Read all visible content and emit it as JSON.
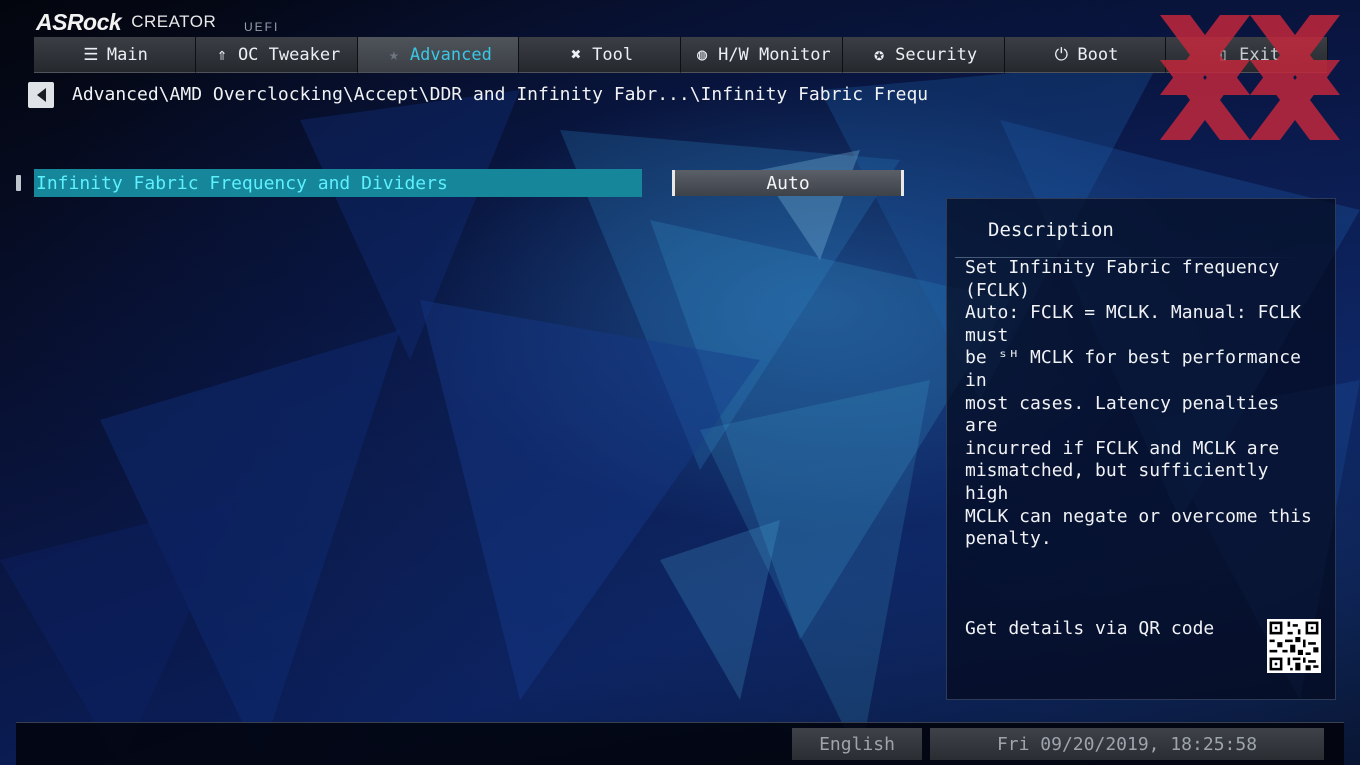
{
  "brand": {
    "name": "ASRock",
    "edition": "CREATOR",
    "suffix": "UEFI"
  },
  "tabs": [
    {
      "label": "Main",
      "icon": "list-icon",
      "active": false
    },
    {
      "label": "OC Tweaker",
      "icon": "rocket-icon",
      "active": false
    },
    {
      "label": "Advanced",
      "icon": "star-icon",
      "active": true
    },
    {
      "label": "Tool",
      "icon": "tools-icon",
      "active": false
    },
    {
      "label": "H/W Monitor",
      "icon": "monitor-gauge-icon",
      "active": false
    },
    {
      "label": "Security",
      "icon": "shield-icon",
      "active": false
    },
    {
      "label": "Boot",
      "icon": "power-icon",
      "active": false
    },
    {
      "label": "Exit",
      "icon": "exit-door-icon",
      "active": false
    }
  ],
  "breadcrumb": "Advanced\\AMD Overclocking\\Accept\\DDR and Infinity Fabr...\\Infinity Fabric Frequ",
  "option": {
    "label": "Infinity Fabric Frequency and Dividers",
    "value": "Auto"
  },
  "description": {
    "title": "Description",
    "text": "Set Infinity Fabric frequency (FCLK)\nAuto: FCLK = MCLK. Manual: FCLK must\nbe ˢᴴ MCLK for best performance in\nmost cases. Latency penalties are\nincurred if FCLK and MCLK are\nmismatched, but sufficiently high\nMCLK can negate or overcome this\npenalty.",
    "qr_label": "Get details via QR code"
  },
  "status": {
    "language": "English",
    "datetime": "Fri 09/20/2019, 18:25:58"
  },
  "colors": {
    "accent": "#39c8e6",
    "highlight_row": "#16869a",
    "highlight_text": "#5df0ff",
    "watermark": "#c8283c"
  }
}
